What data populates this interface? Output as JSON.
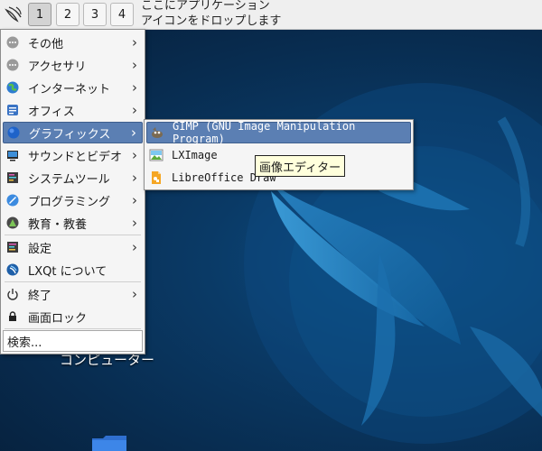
{
  "panel": {
    "desktops": [
      "1",
      "2",
      "3",
      "4"
    ],
    "active_desktop": "1",
    "drop_hint_line1": "ここにアプリケーション",
    "drop_hint_line2": "アイコンをドロップします"
  },
  "menu": {
    "items": [
      {
        "label": "その他",
        "icon": "more-icon"
      },
      {
        "label": "アクセサリ",
        "icon": "accessories-icon"
      },
      {
        "label": "インターネット",
        "icon": "internet-icon"
      },
      {
        "label": "オフィス",
        "icon": "office-icon"
      },
      {
        "label": "グラフィックス",
        "icon": "graphics-icon"
      },
      {
        "label": "サウンドとビデオ",
        "icon": "multimedia-icon"
      },
      {
        "label": "システムツール",
        "icon": "system-tools-icon"
      },
      {
        "label": "プログラミング",
        "icon": "programming-icon"
      },
      {
        "label": "教育・教養",
        "icon": "education-icon"
      },
      {
        "label": "設定",
        "icon": "settings-icon"
      },
      {
        "label": "LXQt について",
        "icon": "lxqt-about-icon"
      },
      {
        "label": "終了",
        "icon": "power-icon"
      },
      {
        "label": "画面ロック",
        "icon": "lock-icon"
      }
    ],
    "search_placeholder": "検索..."
  },
  "submenu": {
    "items": [
      {
        "label": "GIMP (GNU Image Manipulation Program)",
        "icon": "gimp-icon"
      },
      {
        "label": "LXImage",
        "icon": "lximage-icon"
      },
      {
        "label": "LibreOffice Draw",
        "icon": "libreoffice-draw-icon"
      }
    ]
  },
  "tooltip": {
    "text": "画像エディター"
  },
  "desktop": {
    "computer_label": "コンピューター"
  },
  "colors": {
    "highlight": "#5b7fb3",
    "desktop_bg": "#0a3a66"
  }
}
